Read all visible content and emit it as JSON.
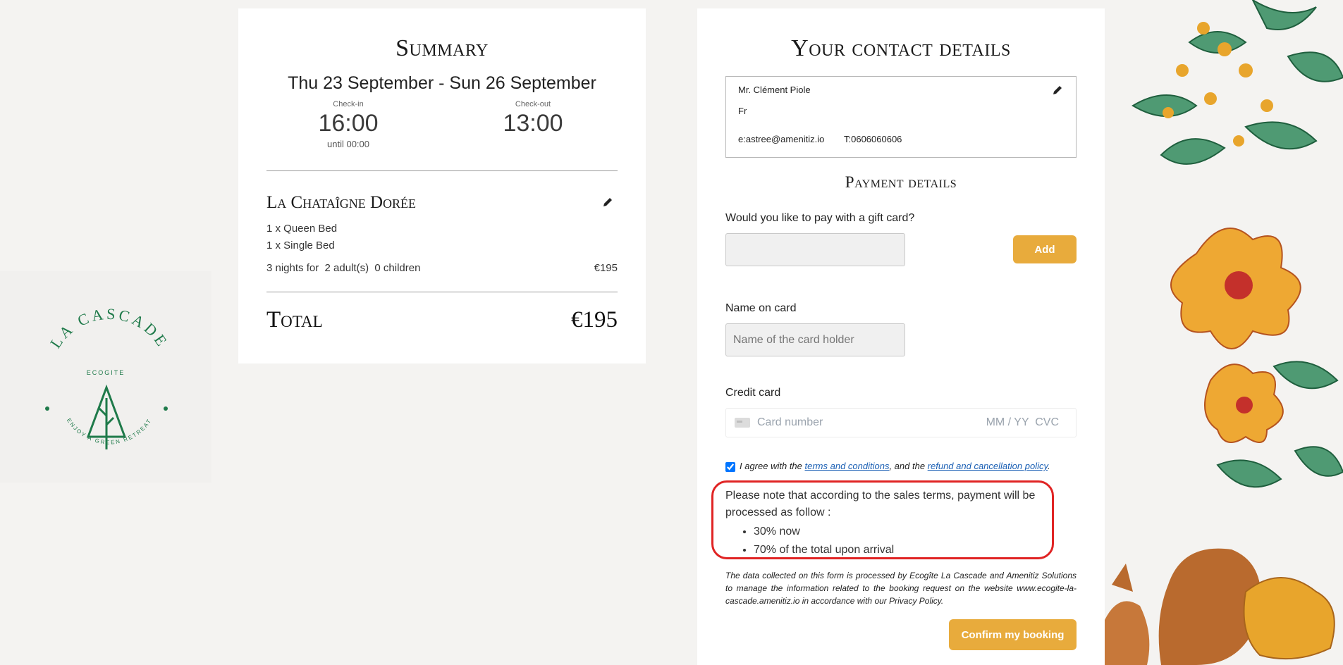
{
  "logo": {
    "name": "LA CASCADE",
    "subtitle": "ECOGITE",
    "tagline": "ENJOY A GREEN RETREAT",
    "color": "#1f7a4a"
  },
  "summary": {
    "title": "Summary",
    "dates": "Thu 23 September - Sun 26 September",
    "checkin_label": "Check-in",
    "checkin_time": "16:00",
    "checkin_note": "until 00:00",
    "checkout_label": "Check-out",
    "checkout_time": "13:00",
    "room_name": "La Chataîgne Dorée",
    "beds": [
      "1 x Queen Bed",
      "1 x Single Bed"
    ],
    "stay": "3 nights for  2 adult(s)  0 children",
    "stay_price": "€195",
    "total_label": "Total",
    "total_value": "€195"
  },
  "contact": {
    "title": "Your contact details",
    "name": "Mr. Clément Piole",
    "lang": "Fr",
    "email": "e:astree@amenitiz.io",
    "phone": "T:0606060606"
  },
  "payment": {
    "title": "Payment details",
    "gift_question": "Would you like to pay with a gift card?",
    "gift_value": "",
    "add_label": "Add",
    "name_label": "Name on card",
    "name_placeholder": "Name of the card holder",
    "card_label": "Credit card",
    "card_placeholder": "Card number",
    "card_exp_placeholder": "MM / YY  CVC",
    "agree_prefix": "I agree with the ",
    "terms_link": "terms and conditions",
    "agree_middle": ", and the ",
    "refund_link": "refund and cancellation policy",
    "agree_suffix": ".",
    "note_text": "Please note that according to the sales terms, payment will be processed as follow :",
    "note_items": [
      "30% now",
      "70% of the total upon arrival"
    ],
    "legal": "The data collected on this form is processed by Ecogîte La Cascade and Amenitiz Solutions to manage the information related to the booking request on the website www.ecogite-la-cascade.amenitiz.io in accordance with our Privacy Policy.",
    "confirm_label": "Confirm my booking"
  },
  "colors": {
    "accent": "#e8ab3c",
    "highlight": "#e02424",
    "link": "#1a5fb4"
  }
}
